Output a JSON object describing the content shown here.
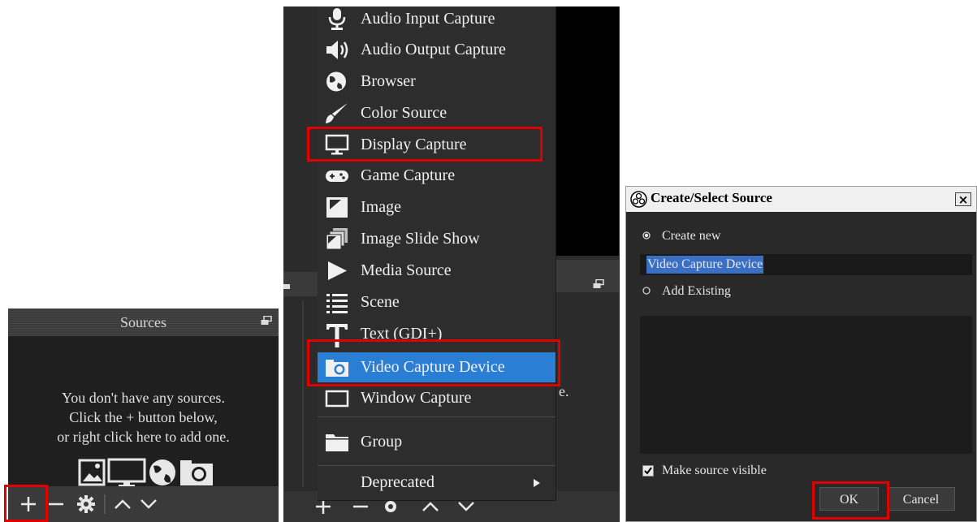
{
  "sources_panel": {
    "title": "Sources",
    "empty_lines": [
      "You don't have any sources.",
      "Click the + button below,",
      "or right click here to add one."
    ],
    "icons": [
      "image-icon",
      "monitor-icon",
      "globe-icon",
      "camera-icon"
    ],
    "toolbar": [
      "plus-icon",
      "minus-icon",
      "gear-icon",
      "chevron-up-icon",
      "chevron-down-icon"
    ]
  },
  "add_menu": {
    "items": [
      {
        "label": "Audio Input Capture",
        "icon": "microphone-icon"
      },
      {
        "label": "Audio Output Capture",
        "icon": "speaker-icon"
      },
      {
        "label": "Browser",
        "icon": "globe-icon"
      },
      {
        "label": "Color Source",
        "icon": "brush-icon"
      },
      {
        "label": "Display Capture",
        "icon": "monitor-icon"
      },
      {
        "label": "Game Capture",
        "icon": "gamepad-icon"
      },
      {
        "label": "Image",
        "icon": "image-icon"
      },
      {
        "label": "Image Slide Show",
        "icon": "slideshow-icon"
      },
      {
        "label": "Media Source",
        "icon": "play-icon"
      },
      {
        "label": "Scene",
        "icon": "list-icon"
      },
      {
        "label": "Text (GDI+)",
        "icon": "text-icon"
      },
      {
        "label": "Video Capture Device",
        "icon": "camera-icon"
      },
      {
        "label": "Window Capture",
        "icon": "window-icon"
      },
      {
        "label": "Group",
        "icon": "folder-icon"
      },
      {
        "label": "Deprecated",
        "icon": "submenu-arrow-icon"
      }
    ],
    "selected": "Video Capture Device",
    "background_text": "e.",
    "highlight_color": "#2a7fd4"
  },
  "dialog": {
    "title": "Create/Select Source",
    "close_label": "×",
    "create_new_label": "Create new",
    "name_value": "Video Capture Device",
    "add_existing_label": "Add Existing",
    "make_visible_label": "Make source visible",
    "make_visible_checked": true,
    "ok_label": "OK",
    "cancel_label": "Cancel"
  },
  "colors": {
    "annotation_red": "#e00000",
    "dark_bg": "#2b2b2b",
    "text_selection": "#3b6fc4"
  }
}
